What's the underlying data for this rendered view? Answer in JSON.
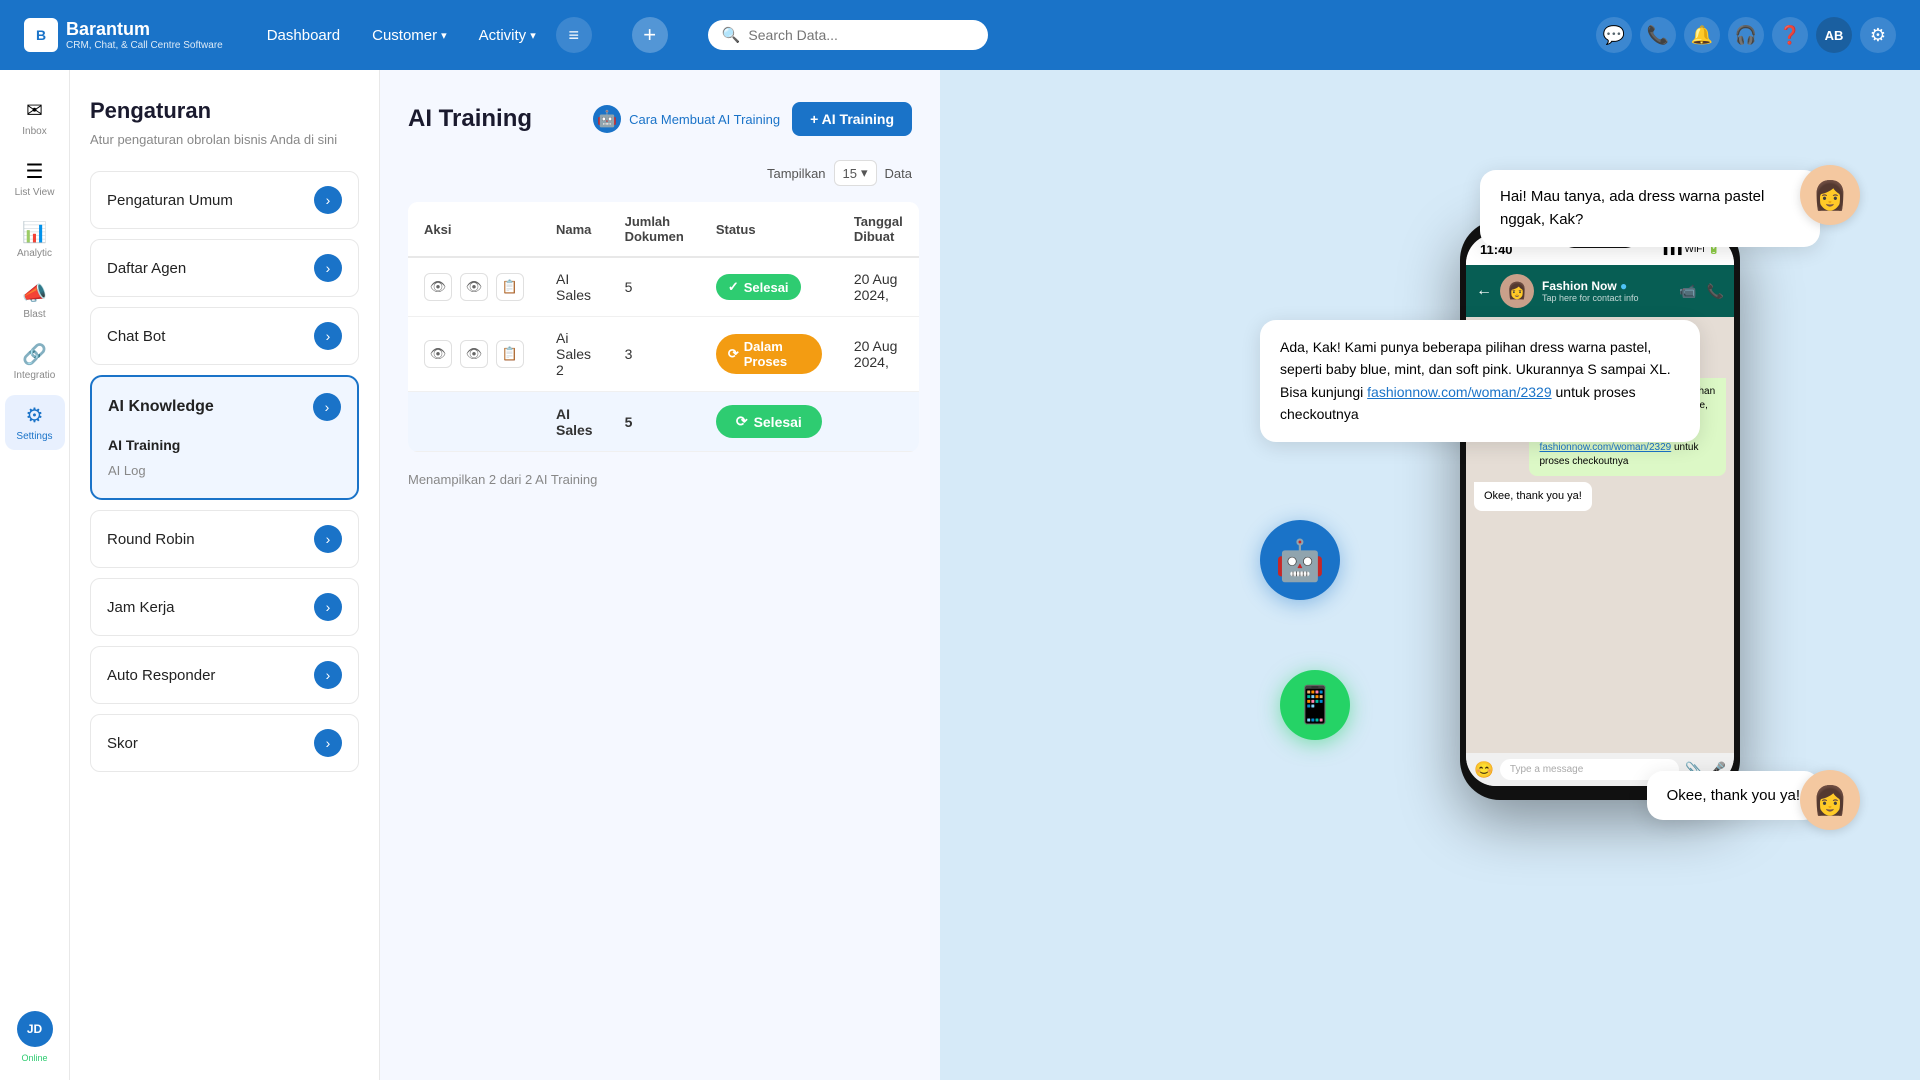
{
  "topnav": {
    "brand": "Barantum",
    "brand_sub": "CRM, Chat, & Call Centre Software",
    "dashboard": "Dashboard",
    "customer": "Customer",
    "activity": "Activity",
    "search_placeholder": "Search Data...",
    "user_initials": "AB"
  },
  "sidebar_icons": [
    {
      "name": "inbox-icon",
      "label": "Inbox",
      "active": false,
      "icon": "✉"
    },
    {
      "name": "list-view-icon",
      "label": "List View",
      "active": false,
      "icon": "☰"
    },
    {
      "name": "analytic-icon",
      "label": "Analytic",
      "active": false,
      "icon": "📊"
    },
    {
      "name": "blast-icon",
      "label": "Blast",
      "active": false,
      "icon": "📣"
    },
    {
      "name": "integration-icon",
      "label": "Integratio",
      "active": false,
      "icon": "🔗"
    },
    {
      "name": "settings-icon",
      "label": "Settings",
      "active": true,
      "icon": "⚙"
    }
  ],
  "settings": {
    "title": "Pengaturan",
    "subtitle": "Atur pengaturan obrolan bisnis Anda di sini",
    "menu_items": [
      {
        "label": "Pengaturan Umum",
        "active": false
      },
      {
        "label": "Daftar Agen",
        "active": false
      },
      {
        "label": "Chat Bot",
        "active": false
      }
    ],
    "ai_knowledge": {
      "title": "AI Knowledge",
      "sub_items": [
        {
          "label": "AI Training",
          "active": true
        },
        {
          "label": "AI Log",
          "active": false
        }
      ]
    },
    "more_items": [
      {
        "label": "Round Robin",
        "active": false
      },
      {
        "label": "Jam Kerja",
        "active": false
      },
      {
        "label": "Auto Responder",
        "active": false
      },
      {
        "label": "Skor",
        "active": false
      }
    ]
  },
  "main": {
    "title": "AI Training",
    "cara_label": "Cara Membuat AI Training",
    "add_button": "+ AI Training",
    "tampilan_label": "Tampilkan",
    "tampilan_value": "15",
    "data_label": "Data",
    "table": {
      "headers": [
        "Aksi",
        "Nama",
        "Jumlah Dokumen",
        "Status",
        "Tanggal Dibuat"
      ],
      "rows": [
        {
          "nama": "AI Sales",
          "jumlah": "5",
          "status": "Selesai",
          "status_type": "green",
          "tanggal": "20 Aug 2024,"
        },
        {
          "nama": "Ai Sales 2",
          "jumlah": "3",
          "status": "Dalam Proses",
          "status_type": "yellow",
          "tanggal": "20 Aug 2024,"
        }
      ],
      "highlight": {
        "nama": "AI Sales",
        "jumlah": "5",
        "status": "Selesai"
      }
    },
    "footer_text": "Menampilkan 2 dari 2 AI Training"
  },
  "phone": {
    "time": "11:40",
    "contact_name": "Fashion Now",
    "contact_sub": "Tap here for contact info",
    "chat": [
      {
        "type": "incoming",
        "text": "Hai! Mau tanya, ada dress warna pastel nggak, Kak?"
      },
      {
        "type": "outgoing",
        "text": "Ada, Kak! Kami punya beberapa pilihan dress warna pastel, seperti baby blue, mint, dan soft pink. Ukurannya S sampai XL. Bisa kunjungi fashionnow.com/woman/2329 untuk proses checkoutnya",
        "link": "fashionnow.com/woman/2329"
      },
      {
        "type": "incoming",
        "text": "Okee, thank you ya!"
      }
    ]
  },
  "bubbles": {
    "question": "Hai! Mau tanya, ada dress warna pastel nggak, Kak?",
    "answer_1": "Ada, Kak! Kami punya beberapa pilihan dress warna pastel, seperti baby blue, mint, dan soft pink. Ukurannya S sampai XL. Bisa kunjungi ",
    "answer_link": "fashionnow.com/woman/2329",
    "answer_2": " untuk proses checkoutnya",
    "ok": "Okee, thank you ya!"
  }
}
